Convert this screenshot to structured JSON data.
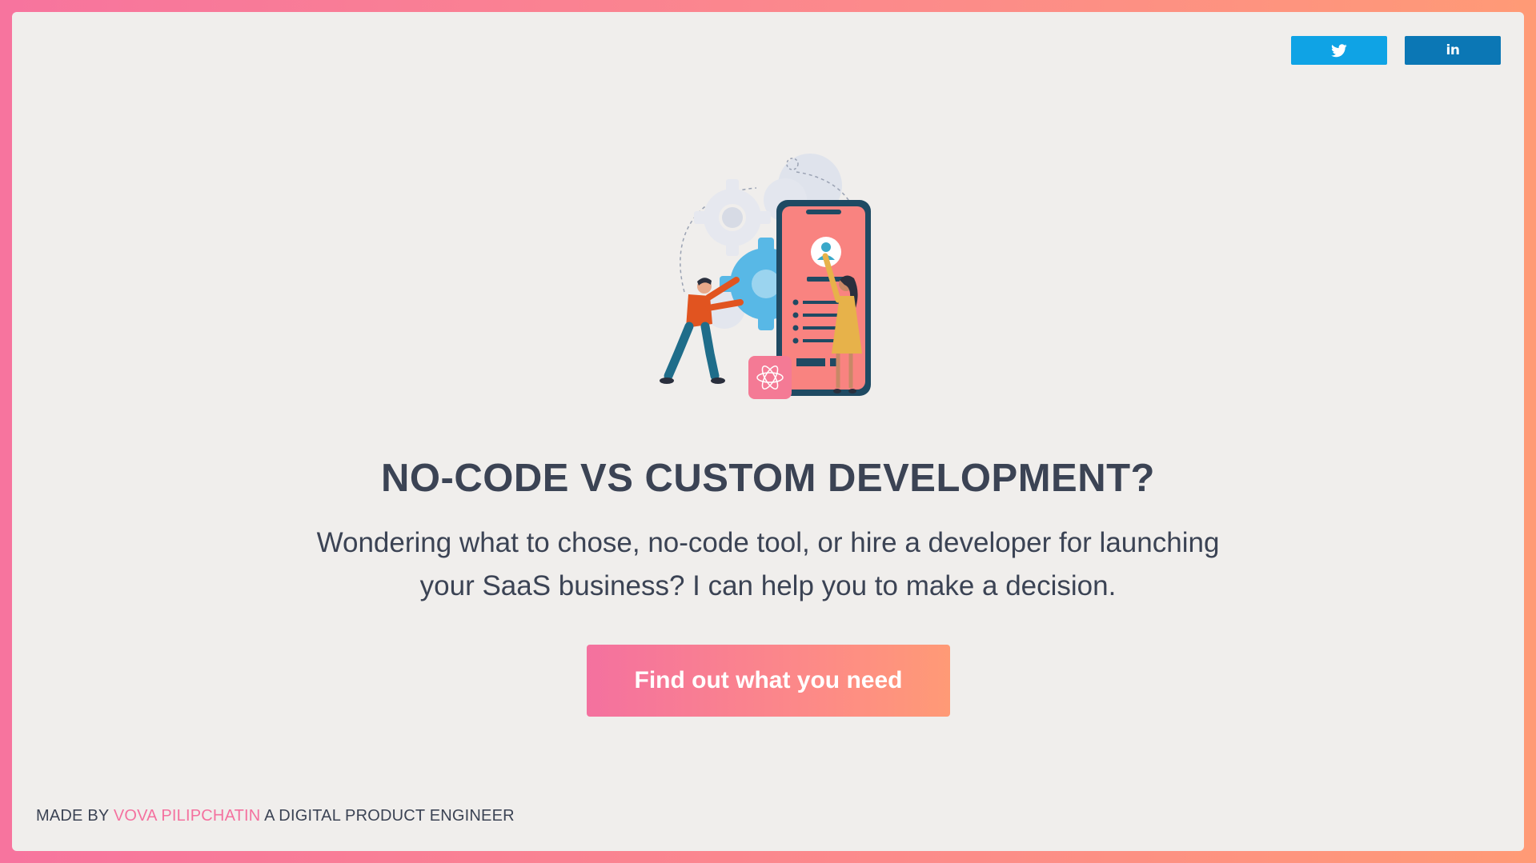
{
  "share": {
    "twitter_icon": "twitter-bird-icon",
    "linkedin_label": "in"
  },
  "hero": {
    "illustration": "people-building-mobile-app-illustration",
    "title": "NO-CODE VS CUSTOM DEVELOPMENT?",
    "description": "Wondering what to chose, no-code tool, or hire a developer for launching your SaaS business? I can help you to make a decision.",
    "cta_label": "Find out what you need"
  },
  "footer": {
    "prefix": "MADE BY",
    "author": "VOVA PILIPCHATIN",
    "suffix": "A DIGITAL PRODUCT ENGINEER"
  },
  "colors": {
    "accent_pink": "#f4719f",
    "accent_orange": "#ff9a76",
    "text_dark": "#3b4354",
    "background": "#f0eeec",
    "twitter_blue": "#0fa3e5",
    "linkedin_blue": "#0b77b5"
  }
}
